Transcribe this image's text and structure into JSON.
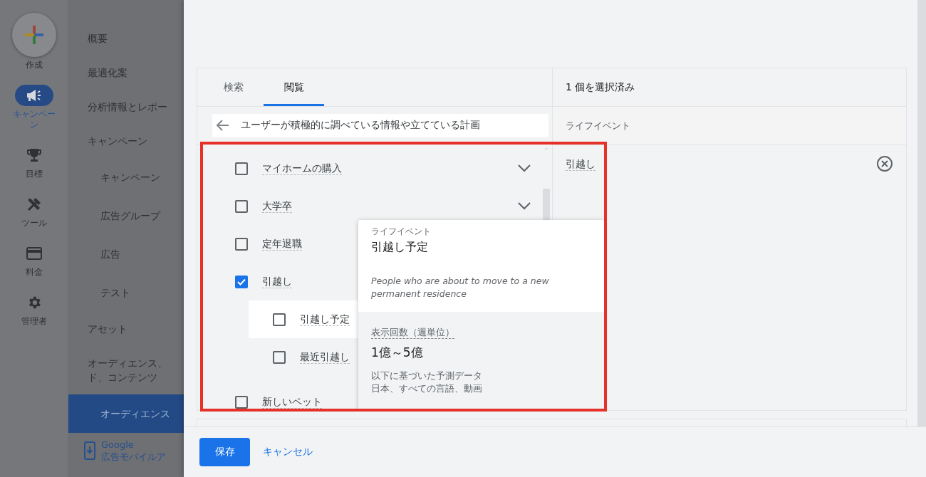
{
  "rail": {
    "items": [
      {
        "kind": "create",
        "label": "作成",
        "selected": false
      },
      {
        "kind": "campaign",
        "label": "キャンペーン",
        "selected": true
      },
      {
        "kind": "goals",
        "label": "目標",
        "selected": false
      },
      {
        "kind": "tools",
        "label": "ツール",
        "selected": false
      },
      {
        "kind": "billing",
        "label": "料金",
        "selected": false
      },
      {
        "kind": "admin",
        "label": "管理者",
        "selected": false
      }
    ]
  },
  "nav": {
    "items": [
      {
        "label": "概要",
        "selected": false
      },
      {
        "label": "最適化案",
        "selected": false
      },
      {
        "label": "分析情報とレポー",
        "selected": false
      },
      {
        "label": "キャンペーン",
        "selected": false,
        "children": [
          {
            "label": "キャンペーン",
            "selected": false
          },
          {
            "label": "広告グループ",
            "selected": false
          },
          {
            "label": "広告",
            "selected": false
          },
          {
            "label": "テスト",
            "selected": false
          }
        ]
      },
      {
        "label": "アセット",
        "selected": false
      },
      {
        "label": "オーディエンス、ド、コンテンツ",
        "selected": false,
        "children": [
          {
            "label": "オーディエンス",
            "selected": true
          }
        ]
      }
    ],
    "promo": {
      "lines": [
        "Google",
        "広告モバイルア"
      ]
    }
  },
  "browser": {
    "tabs": [
      {
        "label": "検索",
        "selected": false
      },
      {
        "label": "閲覧",
        "selected": true
      }
    ],
    "breadcrumb": "ユーザーが積極的に調べている情報や立てている計画",
    "categories": [
      {
        "label": "マイホームの購入",
        "checked": false,
        "expandable": true
      },
      {
        "label": "大学卒",
        "checked": false,
        "expandable": true
      },
      {
        "label": "定年退職",
        "checked": false,
        "expandable": false
      },
      {
        "label": "引越し",
        "checked": true,
        "expandable": false,
        "children": [
          {
            "label": "引越し予定",
            "checked": false,
            "hovered": true
          },
          {
            "label": "最近引越し",
            "checked": false,
            "hovered": false
          }
        ]
      },
      {
        "label": "新しいペット",
        "checked": false,
        "expandable": false
      }
    ]
  },
  "tooltip": {
    "category": "ライフイベント",
    "title": "引越し予定",
    "description": "People who are about to move to a new permanent residence",
    "stat_label": "表示回数（週単位）",
    "stat_value": "1億～5億",
    "basis_label": "以下に基づいた予測データ",
    "basis_detail": "日本、すべての言語、動画"
  },
  "selection": {
    "count": "1 個を選択済み",
    "group": "ライフイベント",
    "items": [
      {
        "label": "引越し"
      }
    ]
  },
  "footer": {
    "save": "保存",
    "cancel": "キャンセル"
  }
}
